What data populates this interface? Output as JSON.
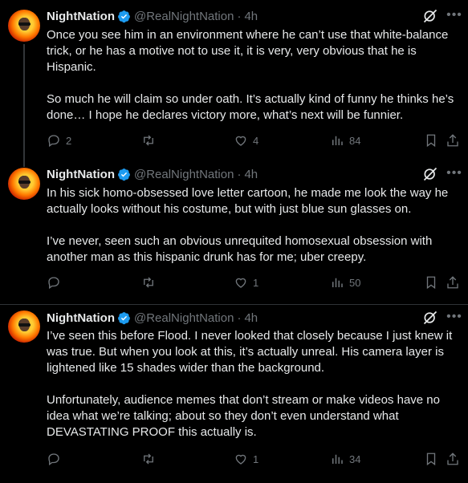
{
  "tweets": [
    {
      "author": "NightNation",
      "handle": "@RealNightNation",
      "separator": "·",
      "time": "4h",
      "paragraphs": [
        "Once you see him in an environment where he can’t use that white-balance trick, or he has a motive not to use it, it is very, very obvious that he is Hispanic.",
        "So much he will claim so under oath. It’s actually kind of funny he thinks he’s done… I hope he declares victory more, what’s next will be funnier."
      ],
      "replies": "2",
      "reposts": "",
      "likes": "4",
      "views": "84"
    },
    {
      "author": "NightNation",
      "handle": "@RealNightNation",
      "separator": "·",
      "time": "4h",
      "paragraphs": [
        "In his sick homo-obsessed love letter cartoon, he made me look the way he actually looks without his costume, but with just blue sun glasses on.",
        "I’ve never, seen such an obvious unrequited homosexual obsession with another man as this hispanic drunk has for me; uber creepy."
      ],
      "replies": "",
      "reposts": "",
      "likes": "1",
      "views": "50"
    },
    {
      "author": "NightNation",
      "handle": "@RealNightNation",
      "separator": "·",
      "time": "4h",
      "paragraphs": [
        "I’ve seen this before Flood. I never looked that closely because I just knew it was true. But when you look at this, it’s actually unreal. His camera layer is lightened like 15 shades wider than the background.",
        "Unfortunately, audience memes that don’t stream or make videos have no idea what we’re talking; about so they don’t even understand what DEVASTATING PROOF this actually is."
      ],
      "replies": "",
      "reposts": "",
      "likes": "1",
      "views": "34"
    }
  ],
  "icons": {
    "verified": "verified-badge-icon",
    "grok": "grok-icon",
    "more": "more-icon",
    "reply": "reply-icon",
    "repost": "repost-icon",
    "like": "like-icon",
    "views": "views-icon",
    "bookmark": "bookmark-icon",
    "share": "share-icon"
  },
  "colors": {
    "background": "#000000",
    "text": "#e7e9ea",
    "muted": "#71767b",
    "verified": "#1d9bf0",
    "divider": "#2f3336"
  }
}
